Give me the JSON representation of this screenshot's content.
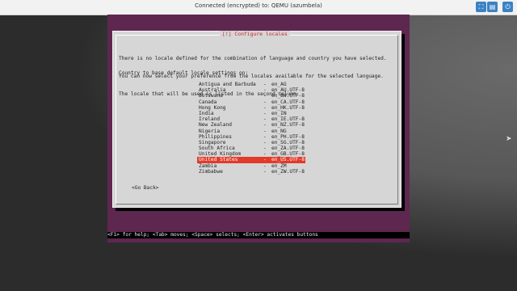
{
  "topbar": {
    "status": "Connected (encrypted) to: QEMU (azumbela)",
    "buttons": [
      {
        "name": "fullscreen-icon",
        "glyph": "⛶"
      },
      {
        "name": "clipboard-icon",
        "glyph": "▤"
      },
      {
        "name": "settings-icon",
        "glyph": "⚙"
      },
      {
        "name": "power-icon",
        "glyph": "⏻"
      }
    ]
  },
  "dialog": {
    "title": "[!] Configure locales",
    "intro_lines": [
      "There is no locale defined for the combination of language and country you have selected.",
      "You can now select your preference from the locales available for the selected language.",
      "The locale that will be used is listed in the second column."
    ],
    "prompt": "Country to base default locale settings on:",
    "locales": [
      {
        "country": "Antigua and Barbuda",
        "code": "en_AG"
      },
      {
        "country": "Australia",
        "code": "en_AU.UTF-8"
      },
      {
        "country": "Botswana",
        "code": "en_BW.UTF-8"
      },
      {
        "country": "Canada",
        "code": "en_CA.UTF-8"
      },
      {
        "country": "Hong Kong",
        "code": "en_HK.UTF-8"
      },
      {
        "country": "India",
        "code": "en_IN"
      },
      {
        "country": "Ireland",
        "code": "en_IE.UTF-8"
      },
      {
        "country": "New Zealand",
        "code": "en_NZ.UTF-8"
      },
      {
        "country": "Nigeria",
        "code": "en_NG"
      },
      {
        "country": "Philippines",
        "code": "en_PH.UTF-8"
      },
      {
        "country": "Singapore",
        "code": "en_SG.UTF-8"
      },
      {
        "country": "South Africa",
        "code": "en_ZA.UTF-8"
      },
      {
        "country": "United Kingdom",
        "code": "en_GB.UTF-8"
      },
      {
        "country": "United States",
        "code": "en_US.UTF-8",
        "selected": true
      },
      {
        "country": "Zambia",
        "code": "en_ZM"
      },
      {
        "country": "Zimbabwe",
        "code": "en_ZW.UTF-8"
      }
    ],
    "go_back": "<Go Back>"
  },
  "helpbar": "<F1> for help; <Tab> moves; <Space> selects; <Enter> activates buttons",
  "colors": {
    "vm_background": "#5e2750",
    "dialog_background": "#d6d6d6",
    "title": "#c72828",
    "selection": "#e23b2a"
  }
}
